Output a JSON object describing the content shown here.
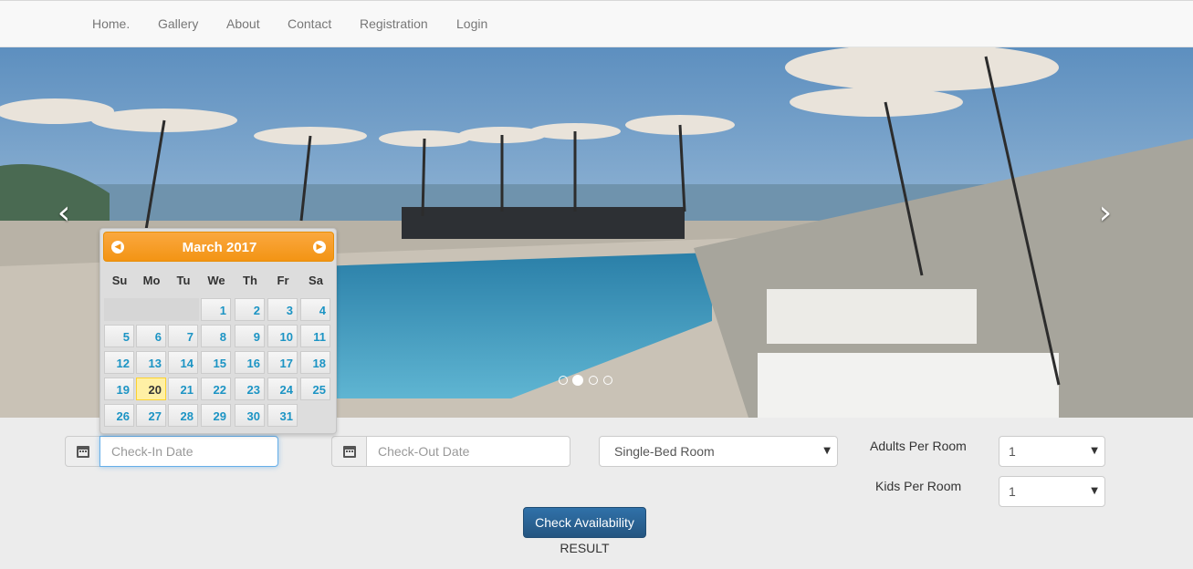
{
  "nav": {
    "items": [
      "Home.",
      "Gallery",
      "About",
      "Contact",
      "Registration",
      "Login"
    ]
  },
  "carousel": {
    "prev_icon": "chevron-left-icon",
    "next_icon": "chevron-right-icon",
    "slide_count": 4,
    "active_slide": 2
  },
  "datepicker": {
    "month_label": "March 2017",
    "weekdays": [
      "Su",
      "Mo",
      "Tu",
      "We",
      "Th",
      "Fr",
      "Sa"
    ],
    "weeks": [
      [
        "",
        "",
        "",
        "1",
        "2",
        "3",
        "4"
      ],
      [
        "5",
        "6",
        "7",
        "8",
        "9",
        "10",
        "11"
      ],
      [
        "12",
        "13",
        "14",
        "15",
        "16",
        "17",
        "18"
      ],
      [
        "19",
        "20",
        "21",
        "22",
        "23",
        "24",
        "25"
      ],
      [
        "26",
        "27",
        "28",
        "29",
        "30",
        "31",
        ""
      ]
    ],
    "highlighted_day": "20",
    "header_color": "#f6a828",
    "day_color": "#1c94c4"
  },
  "form": {
    "checkin_placeholder": "Check-In Date",
    "checkout_placeholder": "Check-Out Date",
    "room_type": "Single-Bed Room",
    "adults_label": "Adults Per Room",
    "adults_value": "1",
    "kids_label": "Kids Per Room",
    "kids_value": "1",
    "check_button": "Check Availability",
    "result_label": "RESULT"
  }
}
